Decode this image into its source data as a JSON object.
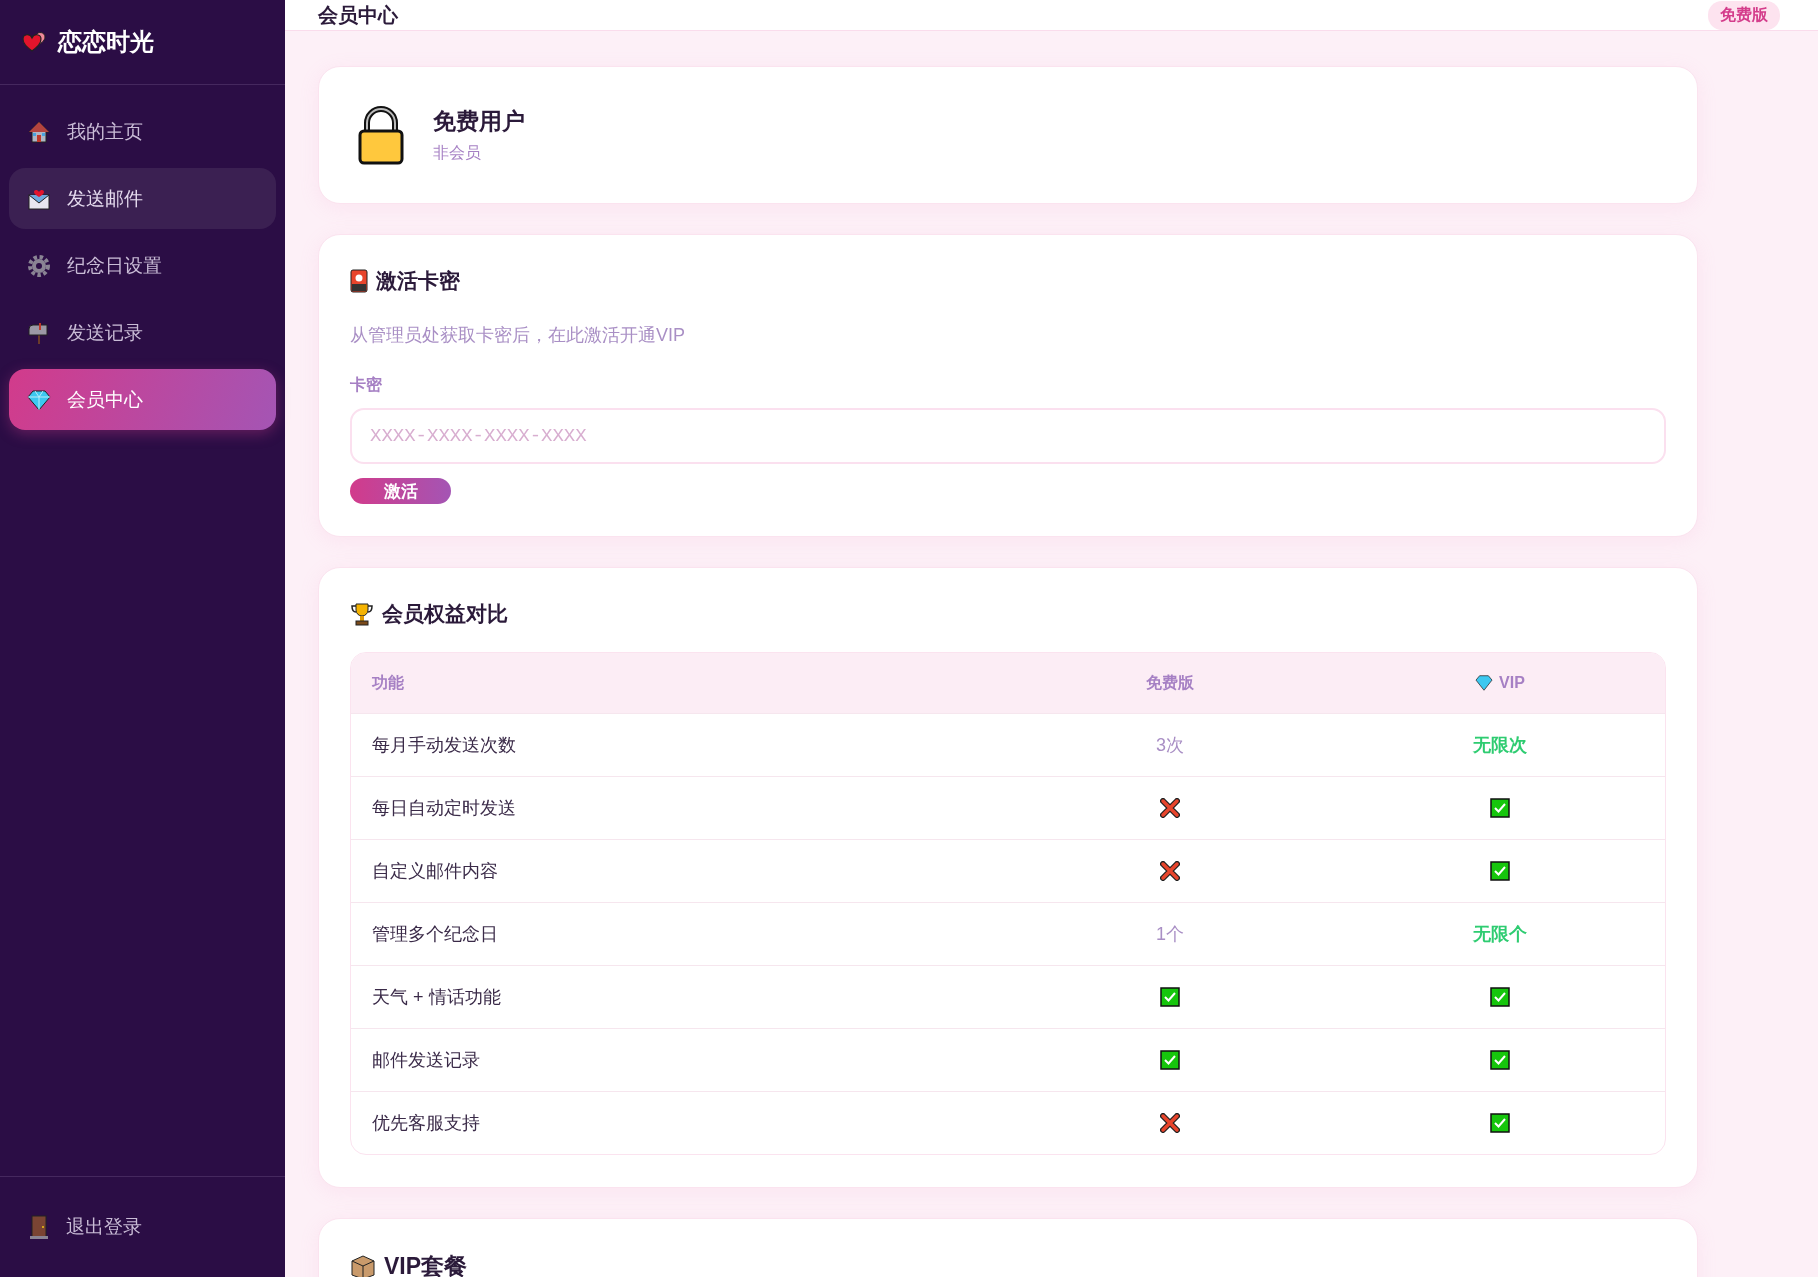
{
  "sidebar": {
    "logo": "恋恋时光",
    "items": [
      {
        "kind": "home",
        "label": "我的主页",
        "selected": false,
        "highlighted": false
      },
      {
        "kind": "mail",
        "label": "发送邮件",
        "selected": false,
        "highlighted": true
      },
      {
        "kind": "gear",
        "label": "纪念日设置",
        "selected": false,
        "highlighted": false
      },
      {
        "kind": "mailbox",
        "label": "发送记录",
        "selected": false,
        "highlighted": false
      },
      {
        "kind": "gem",
        "label": "会员中心",
        "selected": true,
        "highlighted": false
      }
    ],
    "logout": "退出登录"
  },
  "header": {
    "title": "会员中心",
    "badge": "免费版"
  },
  "status_card": {
    "title": "免费用户",
    "subtitle": "非会员"
  },
  "activation": {
    "title": "激活卡密",
    "description": "从管理员处获取卡密后，在此激活开通VIP",
    "field_label": "卡密",
    "placeholder": "XXXX-XXXX-XXXX-XXXX",
    "button": "激活"
  },
  "comparison": {
    "title": "会员权益对比",
    "columns": [
      "功能",
      "免费版",
      "VIP"
    ],
    "rows": [
      [
        {
          "kind": "text",
          "text": "每月手动发送次数"
        },
        {
          "kind": "muted",
          "text": "3次"
        },
        {
          "kind": "highlight",
          "text": "无限次"
        }
      ],
      [
        {
          "kind": "text",
          "text": "每日自动定时发送"
        },
        {
          "kind": "cross"
        },
        {
          "kind": "check"
        }
      ],
      [
        {
          "kind": "text",
          "text": "自定义邮件内容"
        },
        {
          "kind": "cross"
        },
        {
          "kind": "check"
        }
      ],
      [
        {
          "kind": "text",
          "text": "管理多个纪念日"
        },
        {
          "kind": "muted",
          "text": "1个"
        },
        {
          "kind": "highlight",
          "text": "无限个"
        }
      ],
      [
        {
          "kind": "text",
          "text": "天气 + 情话功能"
        },
        {
          "kind": "check"
        },
        {
          "kind": "check"
        }
      ],
      [
        {
          "kind": "text",
          "text": "邮件发送记录"
        },
        {
          "kind": "check"
        },
        {
          "kind": "check"
        }
      ],
      [
        {
          "kind": "text",
          "text": "优先客服支持"
        },
        {
          "kind": "cross"
        },
        {
          "kind": "check"
        }
      ]
    ]
  },
  "plans": {
    "title": "VIP套餐"
  }
}
